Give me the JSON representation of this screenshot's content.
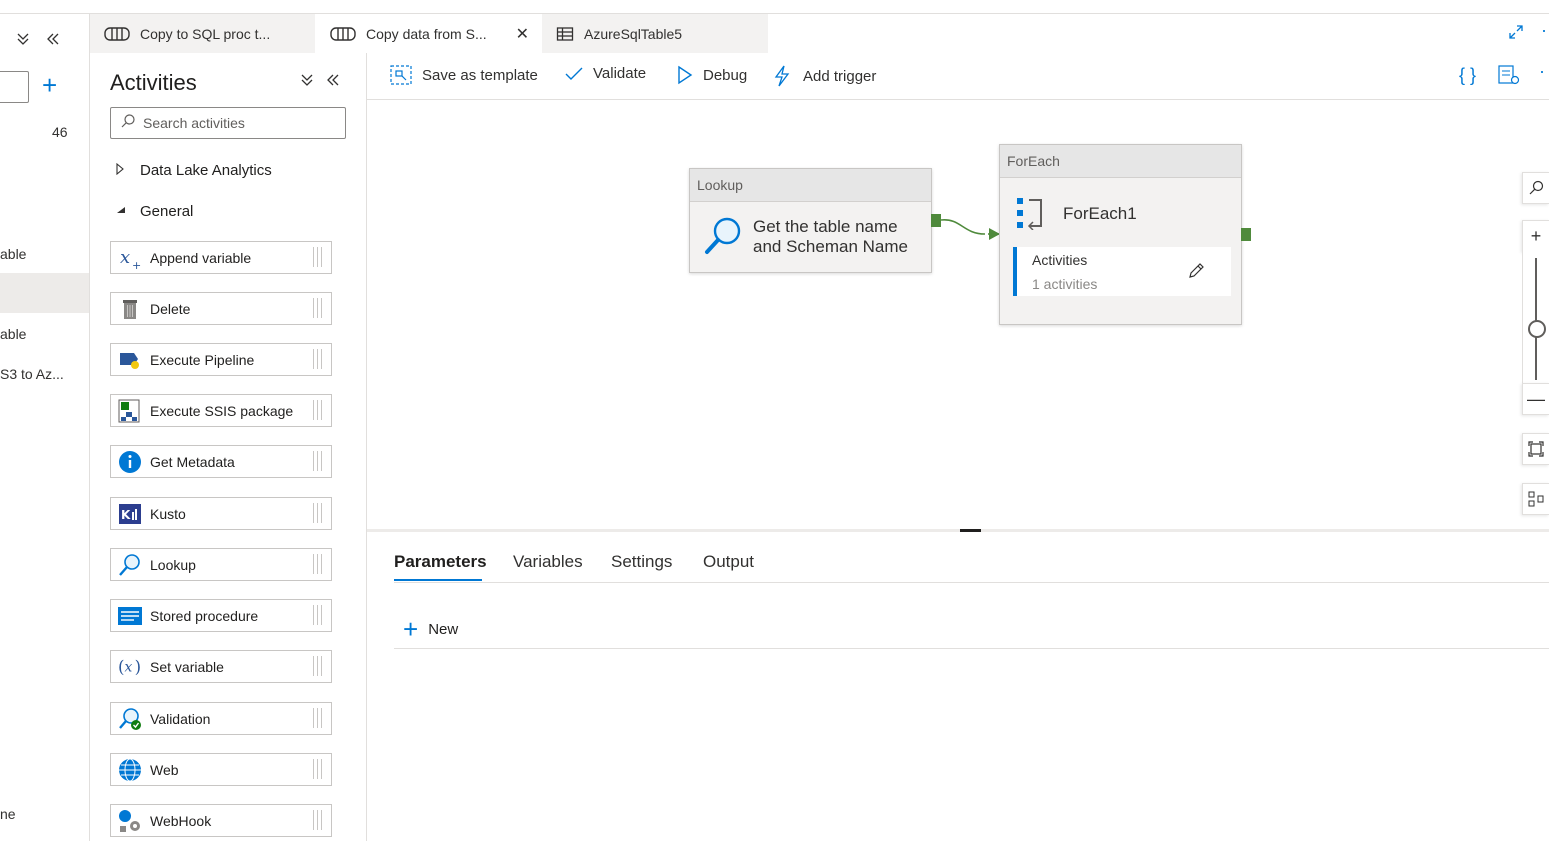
{
  "left_strip": {
    "count": "46",
    "items": [
      "able",
      "able",
      "S3 to Az...",
      "ne"
    ]
  },
  "tabs": [
    {
      "label": "Copy to SQL proc t...",
      "icon": "pipeline-icon"
    },
    {
      "label": "Copy data from S...",
      "icon": "pipeline-icon",
      "active": true
    },
    {
      "label": "AzureSqlTable5",
      "icon": "table-icon"
    }
  ],
  "activities": {
    "title": "Activities",
    "search_placeholder": "Search activities",
    "categories": [
      {
        "label": "Data Lake Analytics",
        "expanded": false
      },
      {
        "label": "General",
        "expanded": true
      }
    ],
    "items": [
      {
        "label": "Append variable",
        "icon": "append-variable-icon"
      },
      {
        "label": "Delete",
        "icon": "delete-icon"
      },
      {
        "label": "Execute Pipeline",
        "icon": "execute-pipeline-icon"
      },
      {
        "label": "Execute SSIS package",
        "icon": "ssis-package-icon"
      },
      {
        "label": "Get Metadata",
        "icon": "info-icon"
      },
      {
        "label": "Kusto",
        "icon": "kusto-icon"
      },
      {
        "label": "Lookup",
        "icon": "lookup-icon"
      },
      {
        "label": "Stored procedure",
        "icon": "stored-procedure-icon"
      },
      {
        "label": "Set variable",
        "icon": "set-variable-icon"
      },
      {
        "label": "Validation",
        "icon": "validation-icon"
      },
      {
        "label": "Web",
        "icon": "web-icon"
      },
      {
        "label": "WebHook",
        "icon": "webhook-icon"
      }
    ]
  },
  "toolbar": {
    "save_template": "Save as template",
    "validate": "Validate",
    "debug": "Debug",
    "add_trigger": "Add trigger"
  },
  "canvas": {
    "lookup_node": {
      "header": "Lookup",
      "line1": "Get the table name",
      "line2": "and Scheman Name"
    },
    "foreach_node": {
      "header": "ForEach",
      "name": "ForEach1",
      "activities_label": "Activities",
      "activities_count": "1 activities"
    }
  },
  "bottom_panel": {
    "tabs": [
      "Parameters",
      "Variables",
      "Settings",
      "Output"
    ],
    "active_tab": "Parameters",
    "new_label": "New"
  },
  "colors": {
    "accent": "#0078d4",
    "port_green": "#4f8a3c"
  }
}
